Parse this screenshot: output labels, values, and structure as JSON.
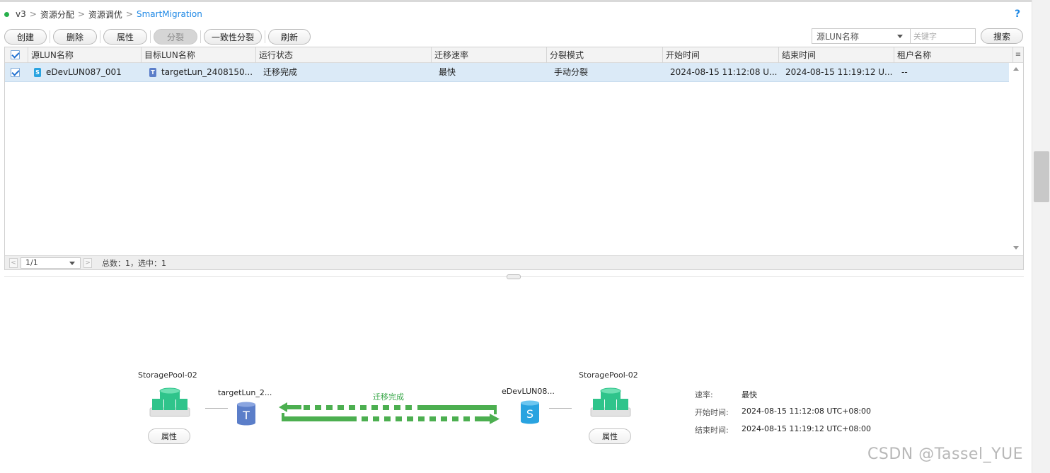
{
  "breadcrumb": {
    "items": [
      "v3",
      "资源分配",
      "资源调优"
    ],
    "current": "SmartMigration",
    "help": "?"
  },
  "toolbar": {
    "create": "创建",
    "delete": "删除",
    "properties": "属性",
    "split": "分裂",
    "consistent_split": "一致性分裂",
    "refresh": "刷新"
  },
  "search": {
    "field": "源LUN名称",
    "placeholder": "关键字",
    "button": "搜索"
  },
  "table": {
    "columns": [
      "源LUN名称",
      "目标LUN名称",
      "运行状态",
      "迁移速率",
      "分裂模式",
      "开始时间",
      "结束时间",
      "租户名称"
    ],
    "rows": [
      {
        "selected": true,
        "source_lun": "eDevLUN087_001",
        "source_icon": "S",
        "target_lun": "targetLun_2408150...",
        "target_icon": "T",
        "status": "迁移完成",
        "rate": "最快",
        "split_mode": "手动分裂",
        "start_time": "2024-08-15 11:12:08 U...",
        "end_time": "2024-08-15 11:19:12 U...",
        "tenant": "--"
      }
    ]
  },
  "pager": {
    "page": "1/1",
    "summary": "总数：1，选中：1"
  },
  "diagram": {
    "left_pool": "StoragePool-02",
    "right_pool": "StoragePool-02",
    "target_lun": "targetLun_2...",
    "target_icon": "T",
    "source_lun": "eDevLUN08...",
    "source_icon": "S",
    "status": "迁移完成",
    "left_props": "属性",
    "right_props": "属性"
  },
  "info": {
    "rate_label": "速率:",
    "rate_value": "最快",
    "start_label": "开始时间:",
    "start_value": "2024-08-15 11:12:08 UTC+08:00",
    "end_label": "结束时间:",
    "end_value": "2024-08-15 11:19:12 UTC+08:00"
  },
  "watermark": "CSDN @Tassel_YUE",
  "colors": {
    "accent": "#1e88e5",
    "pool_green": "#2fc48b",
    "arrow_green": "#4caf50",
    "row_selected": "#dbeaf7",
    "status_dot": "#27b04b"
  }
}
